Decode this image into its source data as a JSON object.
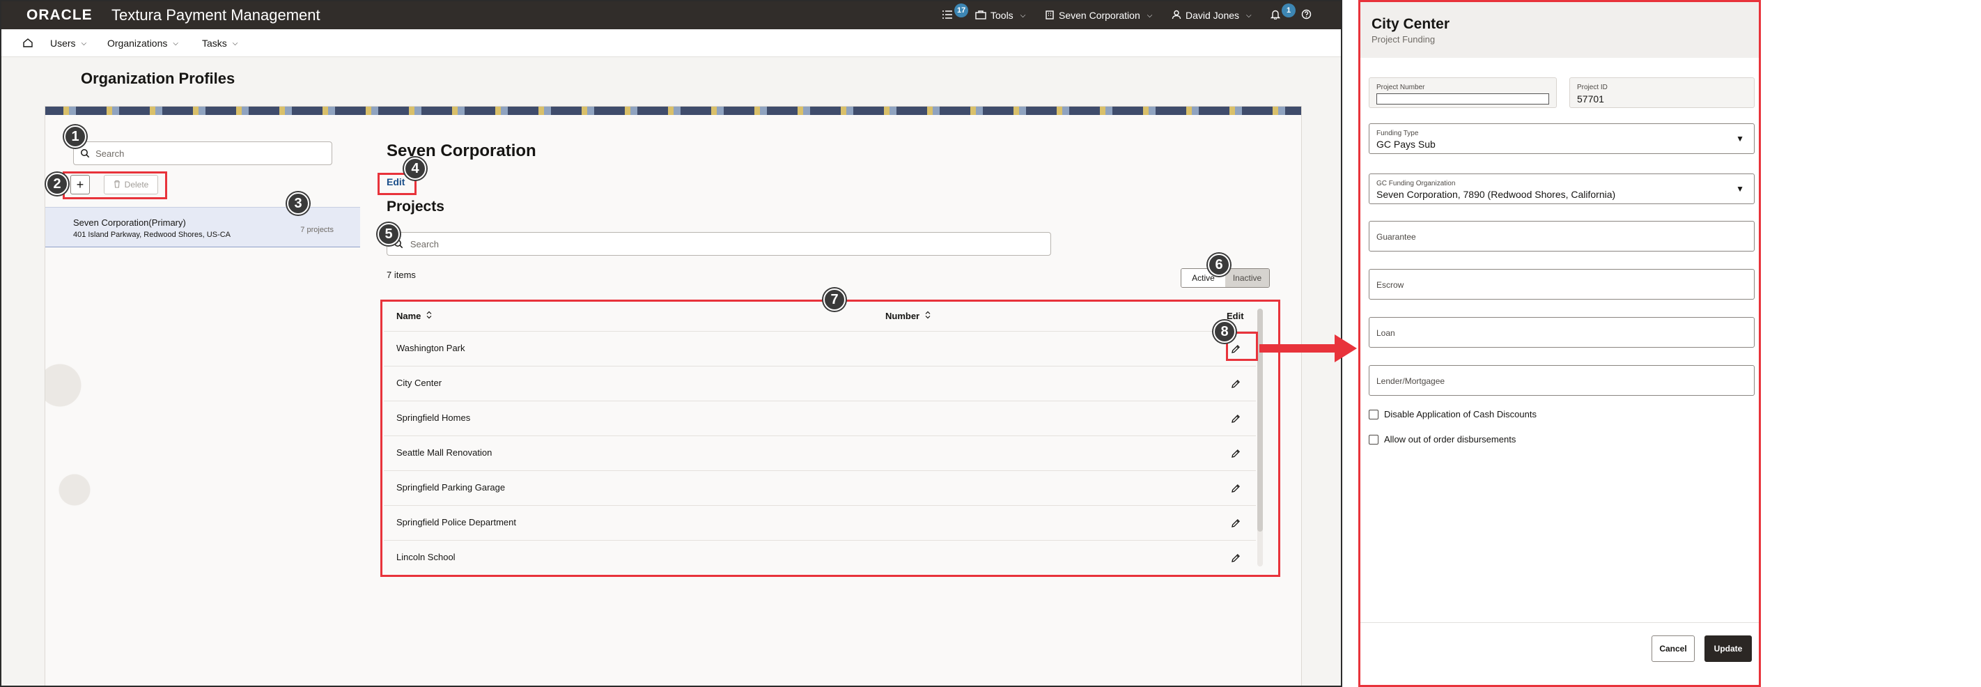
{
  "app": {
    "logo": "ORACLE",
    "product": "Textura Payment Management",
    "header": {
      "tasks_badge": "17",
      "tools_label": "Tools",
      "org_label": "Seven Corporation",
      "user_label": "David Jones",
      "notifications_badge": "1"
    },
    "nav": [
      {
        "label": "Users"
      },
      {
        "label": "Organizations"
      },
      {
        "label": "Tasks"
      }
    ],
    "page_title": "Organization Profiles"
  },
  "left_panel": {
    "search_placeholder": "Search",
    "delete_label": "Delete",
    "org": {
      "name": "Seven Corporation(Primary)",
      "address": "401 Island Parkway, Redwood Shores, US-CA",
      "count": "7 projects"
    }
  },
  "detail": {
    "org_title": "Seven Corporation",
    "edit_label": "Edit",
    "projects_heading": "Projects",
    "search_placeholder": "Search",
    "items_count": "7 items",
    "toggle": {
      "active": "Active",
      "inactive": "Inactive"
    },
    "table": {
      "col_name": "Name",
      "col_number": "Number",
      "col_edit": "Edit",
      "rows": [
        {
          "name": "Washington Park"
        },
        {
          "name": "City Center"
        },
        {
          "name": "Springfield Homes"
        },
        {
          "name": "Seattle Mall Renovation"
        },
        {
          "name": "Springfield Parking Garage"
        },
        {
          "name": "Springfield Police Department"
        },
        {
          "name": "Lincoln School"
        }
      ]
    }
  },
  "callouts": [
    "1",
    "2",
    "3",
    "4",
    "5",
    "6",
    "7",
    "8"
  ],
  "dialog": {
    "title": "City Center",
    "subtitle": "Project Funding",
    "project_number_label": "Project Number",
    "project_id_label": "Project ID",
    "project_id_value": "57701",
    "funding_type_label": "Funding Type",
    "funding_type_value": "GC Pays Sub",
    "gc_org_label": "GC Funding Organization",
    "gc_org_value": "Seven Corporation, 7890 (Redwood Shores, California)",
    "guarantee": "Guarantee",
    "escrow": "Escrow",
    "loan": "Loan",
    "lender": "Lender/Mortgagee",
    "chk_cash": "Disable Application of Cash Discounts",
    "chk_order": "Allow out of order disbursements",
    "cancel_label": "Cancel",
    "update_label": "Update"
  },
  "colors": {
    "topbar": "#312d2a",
    "accent_blue": "#1b4f8a",
    "annotation_red": "#e8333b",
    "badge_blue": "#3d86b3"
  }
}
